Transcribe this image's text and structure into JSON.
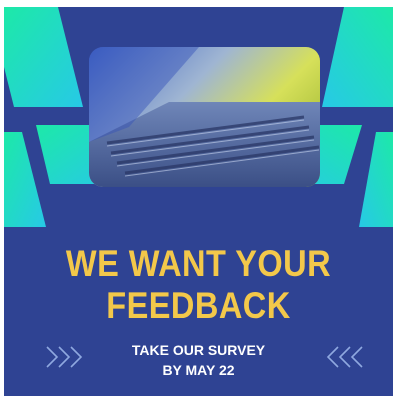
{
  "headline": {
    "line1": "WE WANT YOUR",
    "line2": "FEEDBACK"
  },
  "subheadline": {
    "line1": "TAKE OUR SURVEY",
    "line2": "BY MAY 22"
  },
  "colors": {
    "background": "#2f4393",
    "headline": "#f3c84a",
    "subheadline": "#ffffff",
    "accent_teal": "#1fe3b0",
    "accent_cyan": "#29c9e8",
    "chevron": "#8fa8e0"
  },
  "icons": {
    "left": "chevron-right-triple-icon",
    "right": "chevron-left-triple-icon"
  }
}
